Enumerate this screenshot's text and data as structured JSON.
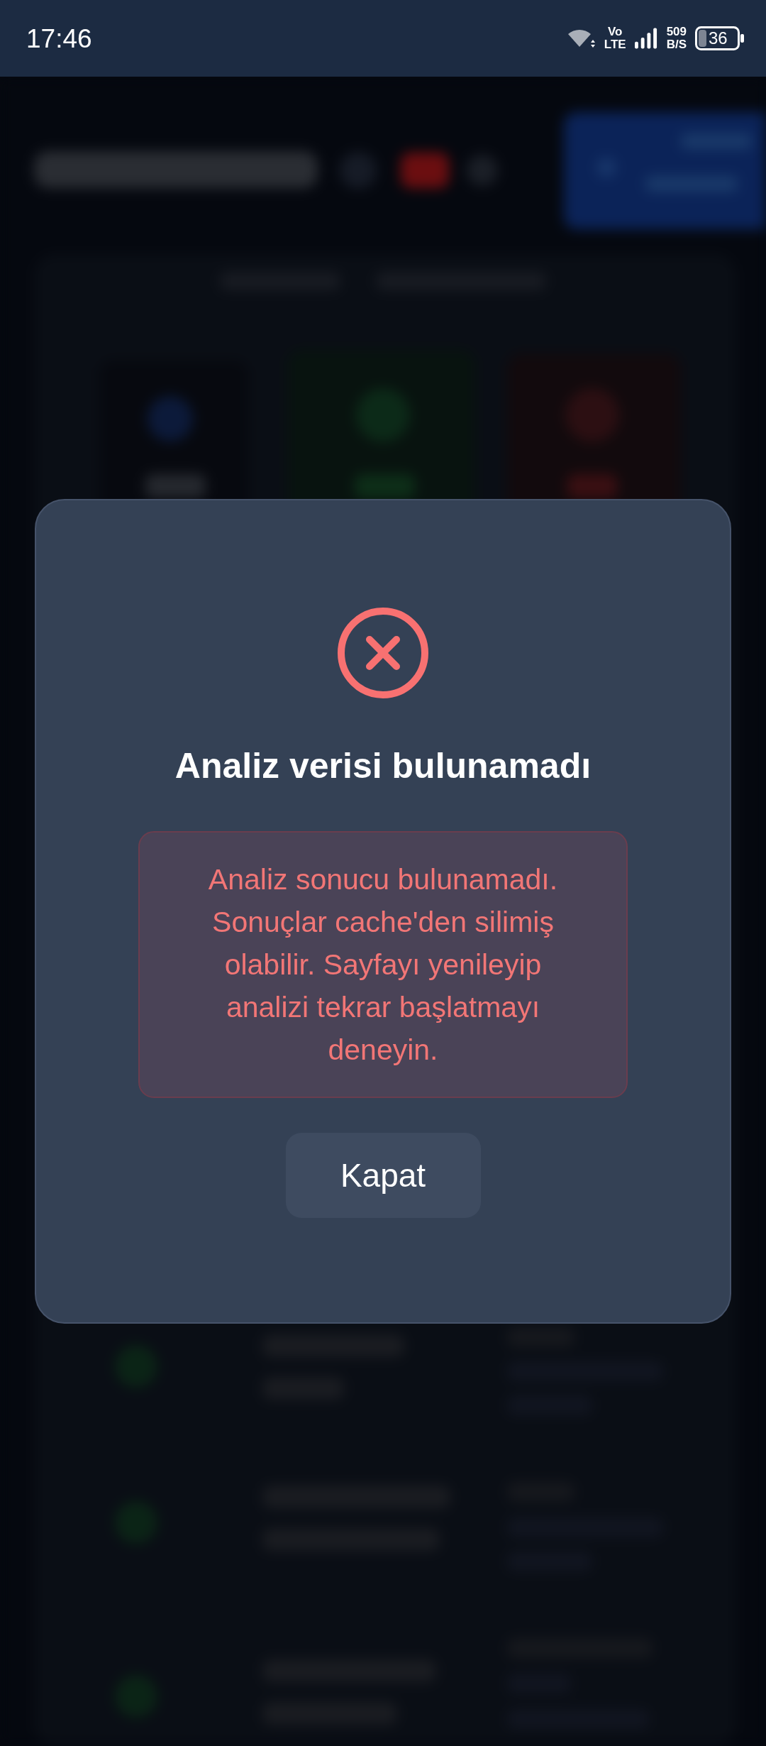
{
  "status_bar": {
    "time": "17:46",
    "network_type": [
      "Vo",
      "LTE"
    ],
    "data_speed": [
      "509",
      "B/S"
    ],
    "battery": "36"
  },
  "dialog": {
    "title": "Analiz verisi bulunamadı",
    "message": "Analiz sonucu bulunamadı. Sonuçlar cache'den silimiş olabilir. Sayfayı yenileyip analizi tekrar başlatmayı deneyin.",
    "button": "Kapat"
  }
}
